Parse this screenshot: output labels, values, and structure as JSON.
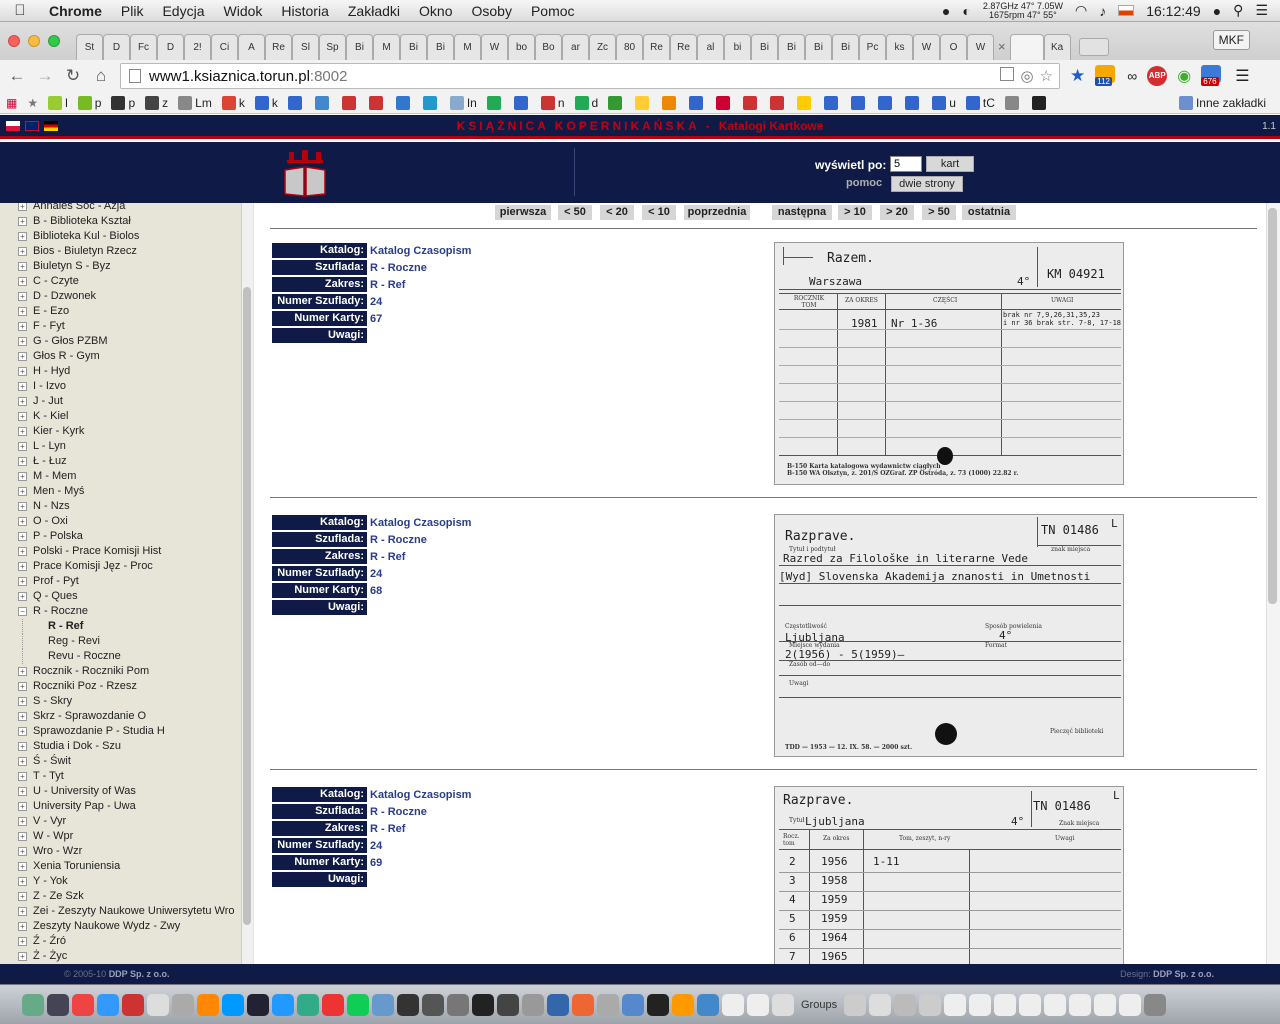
{
  "menubar": {
    "app": "Chrome",
    "items": [
      "Plik",
      "Edycja",
      "Widok",
      "Historia",
      "Zakładki",
      "Okno",
      "Osoby",
      "Pomoc"
    ],
    "cpu": "2.87GHz",
    "rpm": "1675rpm",
    "temp1": "47° 7.05W",
    "temp2": "47° 55°",
    "clock": "16:12:49"
  },
  "tabs": [
    "St",
    "D",
    "Fc",
    "D",
    "2!",
    "Ci",
    "A",
    "Re",
    "Sl",
    "Sp",
    "Bi",
    "M",
    "Bi",
    "Bi",
    "M",
    "W",
    "bo",
    "Bo",
    "ar",
    "Zc",
    "80",
    "Re",
    "Re",
    "al",
    "bi",
    "Bi",
    "Bi",
    "Bi",
    "Bi",
    "Pc",
    "ks",
    "W",
    "O",
    "W",
    "",
    "Ka"
  ],
  "profile": "MKF",
  "address": {
    "host": "www1.ksiaznica.torun.pl",
    "port": ":8002"
  },
  "extensions": {
    "badge1": "112",
    "badge2": "676",
    "abp": "ABP"
  },
  "bookmarks": [
    "l",
    "p",
    "p",
    "z",
    "Lm",
    "k",
    "k",
    "",
    "",
    "",
    "",
    "",
    "",
    "In",
    "",
    "",
    "n",
    "d",
    "",
    "",
    "",
    "",
    "",
    "",
    "",
    "",
    "",
    "",
    "",
    "",
    "u",
    "tC",
    "",
    ""
  ],
  "other_bookmarks": "Inne zakładki",
  "site": {
    "title": "KSIĄŻNICA KOPERNIKAŃSKA",
    "title_sep": "-",
    "subtitle": "Katalogi Kartkowe",
    "version": "1.1",
    "shown_label": "wyświetl po:",
    "per_page": "5",
    "kart_button": "kart",
    "help_label": "pomoc",
    "two_pages_button": "dwie strony"
  },
  "pager": {
    "first": "pierwsza",
    "back50": "< 50",
    "back20": "< 20",
    "back10": "< 10",
    "prev": "poprzednia",
    "next": "następna",
    "fwd10": "> 10",
    "fwd20": "> 20",
    "fwd50": "> 50",
    "last": "ostatnia"
  },
  "labels": {
    "katalog": "Katalog:",
    "szuflada": "Szuflada:",
    "zakres": "Zakres:",
    "numer_szuflady": "Numer Szuflady:",
    "numer_karty": "Numer Karty:",
    "uwagi": "Uwagi:"
  },
  "sidebar": {
    "items": [
      "Annales Soc - Azja",
      "B - Biblioteka Kształ",
      "Biblioteka Kul - Biolos",
      "Bios - Biuletyn Rzecz",
      "Biuletyn S - Byz",
      "C - Czyte",
      "D - Dzwonek",
      "E - Ezo",
      "F - Fyt",
      "G - Głos PZBM",
      "Głos R - Gym",
      "H - Hyd",
      "I - Izvo",
      "J - Jut",
      "K - Kiel",
      "Kier - Kyrk",
      "L - Lyn",
      "Ł - Łuz",
      "M - Mem",
      "Men - Myś",
      "N - Nzs",
      "O - Oxi",
      "P - Polska",
      "Polski - Prace Komisji Hist",
      "Prace Komisji Jęz - Proc",
      "Prof - Pyt",
      "Q - Ques",
      "R - Roczne"
    ],
    "subitems": [
      "R - Ref",
      "Reg - Revi",
      "Revu - Roczne"
    ],
    "items2": [
      "Rocznik - Roczniki Pom",
      "Roczniki Poz - Rzesz",
      "S - Skry",
      "Skrz - Sprawozdanie O",
      "Sprawozdanie P - Studia H",
      "Studia i Dok - Szu",
      "Ś - Świt",
      "T - Tyt",
      "U - University of Was",
      "University Pap - Uwa",
      "V - Vyr",
      "W - Wpr",
      "Wro - Wzr",
      "Xenia Toruniensia",
      "Y - Yok",
      "Z - Ze Szk",
      "Zei - Zeszyty Naukowe Uniwersytetu Wro",
      "Zeszyty Naukowe Wydz - Zwy",
      "Ź - Źró",
      "Ż - Życ"
    ]
  },
  "entries": [
    {
      "katalog": "Katalog Czasopism",
      "szuflada": "R - Roczne",
      "zakres": "R - Ref",
      "numer_szuflady": "24",
      "numer_karty": "67",
      "uwagi": "",
      "card": {
        "title": "Razem.",
        "place": "Warszawa",
        "format": "4°",
        "sig": "KM 04921",
        "h1": "ROCZNIK TOM",
        "h2": "ZA OKRES",
        "h3": "CZĘŚCI",
        "h4": "UWAGI",
        "year": "1981",
        "part": "Nr 1-36",
        "note1": "brak nr 7,9,26,31,35,23",
        "note2": "i nr 36 brak str. 7-8, 17-18",
        "print1": "B-150 Karta katalogowa wydawnictw ciągłych",
        "print2": "B-150 WA Olsztyn, z. 201/S OZGraf. ZP Ostróda, z. 73 (1000) 22.82 r."
      }
    },
    {
      "katalog": "Katalog Czasopism",
      "szuflada": "R - Roczne",
      "zakres": "R - Ref",
      "numer_szuflady": "24",
      "numer_karty": "68",
      "uwagi": "",
      "card": {
        "title": "Razprave.",
        "sig": "TN 01486",
        "corner": "L",
        "l_title": "Tytuł i podtytuł",
        "l_sig": "znak miejsca",
        "line1": "Razred za Filološke in literarne Vede",
        "line2": "[Wyd] Slovenska Akademija znanosti in Umetnosti",
        "l_freq": "Częstotliwość",
        "l_acq": "Sposób powielenia",
        "format": "4°",
        "place": "Ljubljana",
        "l_place": "Miejsce wydania",
        "l_format": "Format",
        "holdings": "2(1956) - 5(1959)—",
        "l_range": "Zasób od—do",
        "l_notes": "Uwagi",
        "l_stamp": "Pieczęć biblioteki",
        "print1": "TDD — 1953 — 12. IX. 58. — 2000 szt."
      }
    },
    {
      "katalog": "Katalog Czasopism",
      "szuflada": "R - Roczne",
      "zakres": "R - Ref",
      "numer_szuflady": "24",
      "numer_karty": "69",
      "uwagi": "",
      "card": {
        "title": "Razprave.",
        "sig": "TN 01486",
        "corner": "L",
        "l_title": "Tytuł",
        "l_sig": "Znak miejsca",
        "place": "Ljubljana",
        "format": "4°",
        "h1": "Rocz. tom",
        "h2": "Za okres",
        "h3": "Tom, zeszyt, n-ry",
        "h4": "Uwagi",
        "rows": [
          [
            "2",
            "1956",
            "1-11"
          ],
          [
            "3",
            "1958",
            ""
          ],
          [
            "4",
            "1959",
            ""
          ],
          [
            "5",
            "1959",
            ""
          ],
          [
            "6",
            "1964",
            ""
          ],
          [
            "7",
            "1965",
            ""
          ]
        ]
      }
    }
  ],
  "footer": {
    "copyright": "© 2005-10",
    "company": "DDP Sp. z o.o.",
    "design_label": "Design:",
    "design_company": "DDP Sp. z o.o."
  },
  "dock": {
    "groups_label": "Groups"
  }
}
